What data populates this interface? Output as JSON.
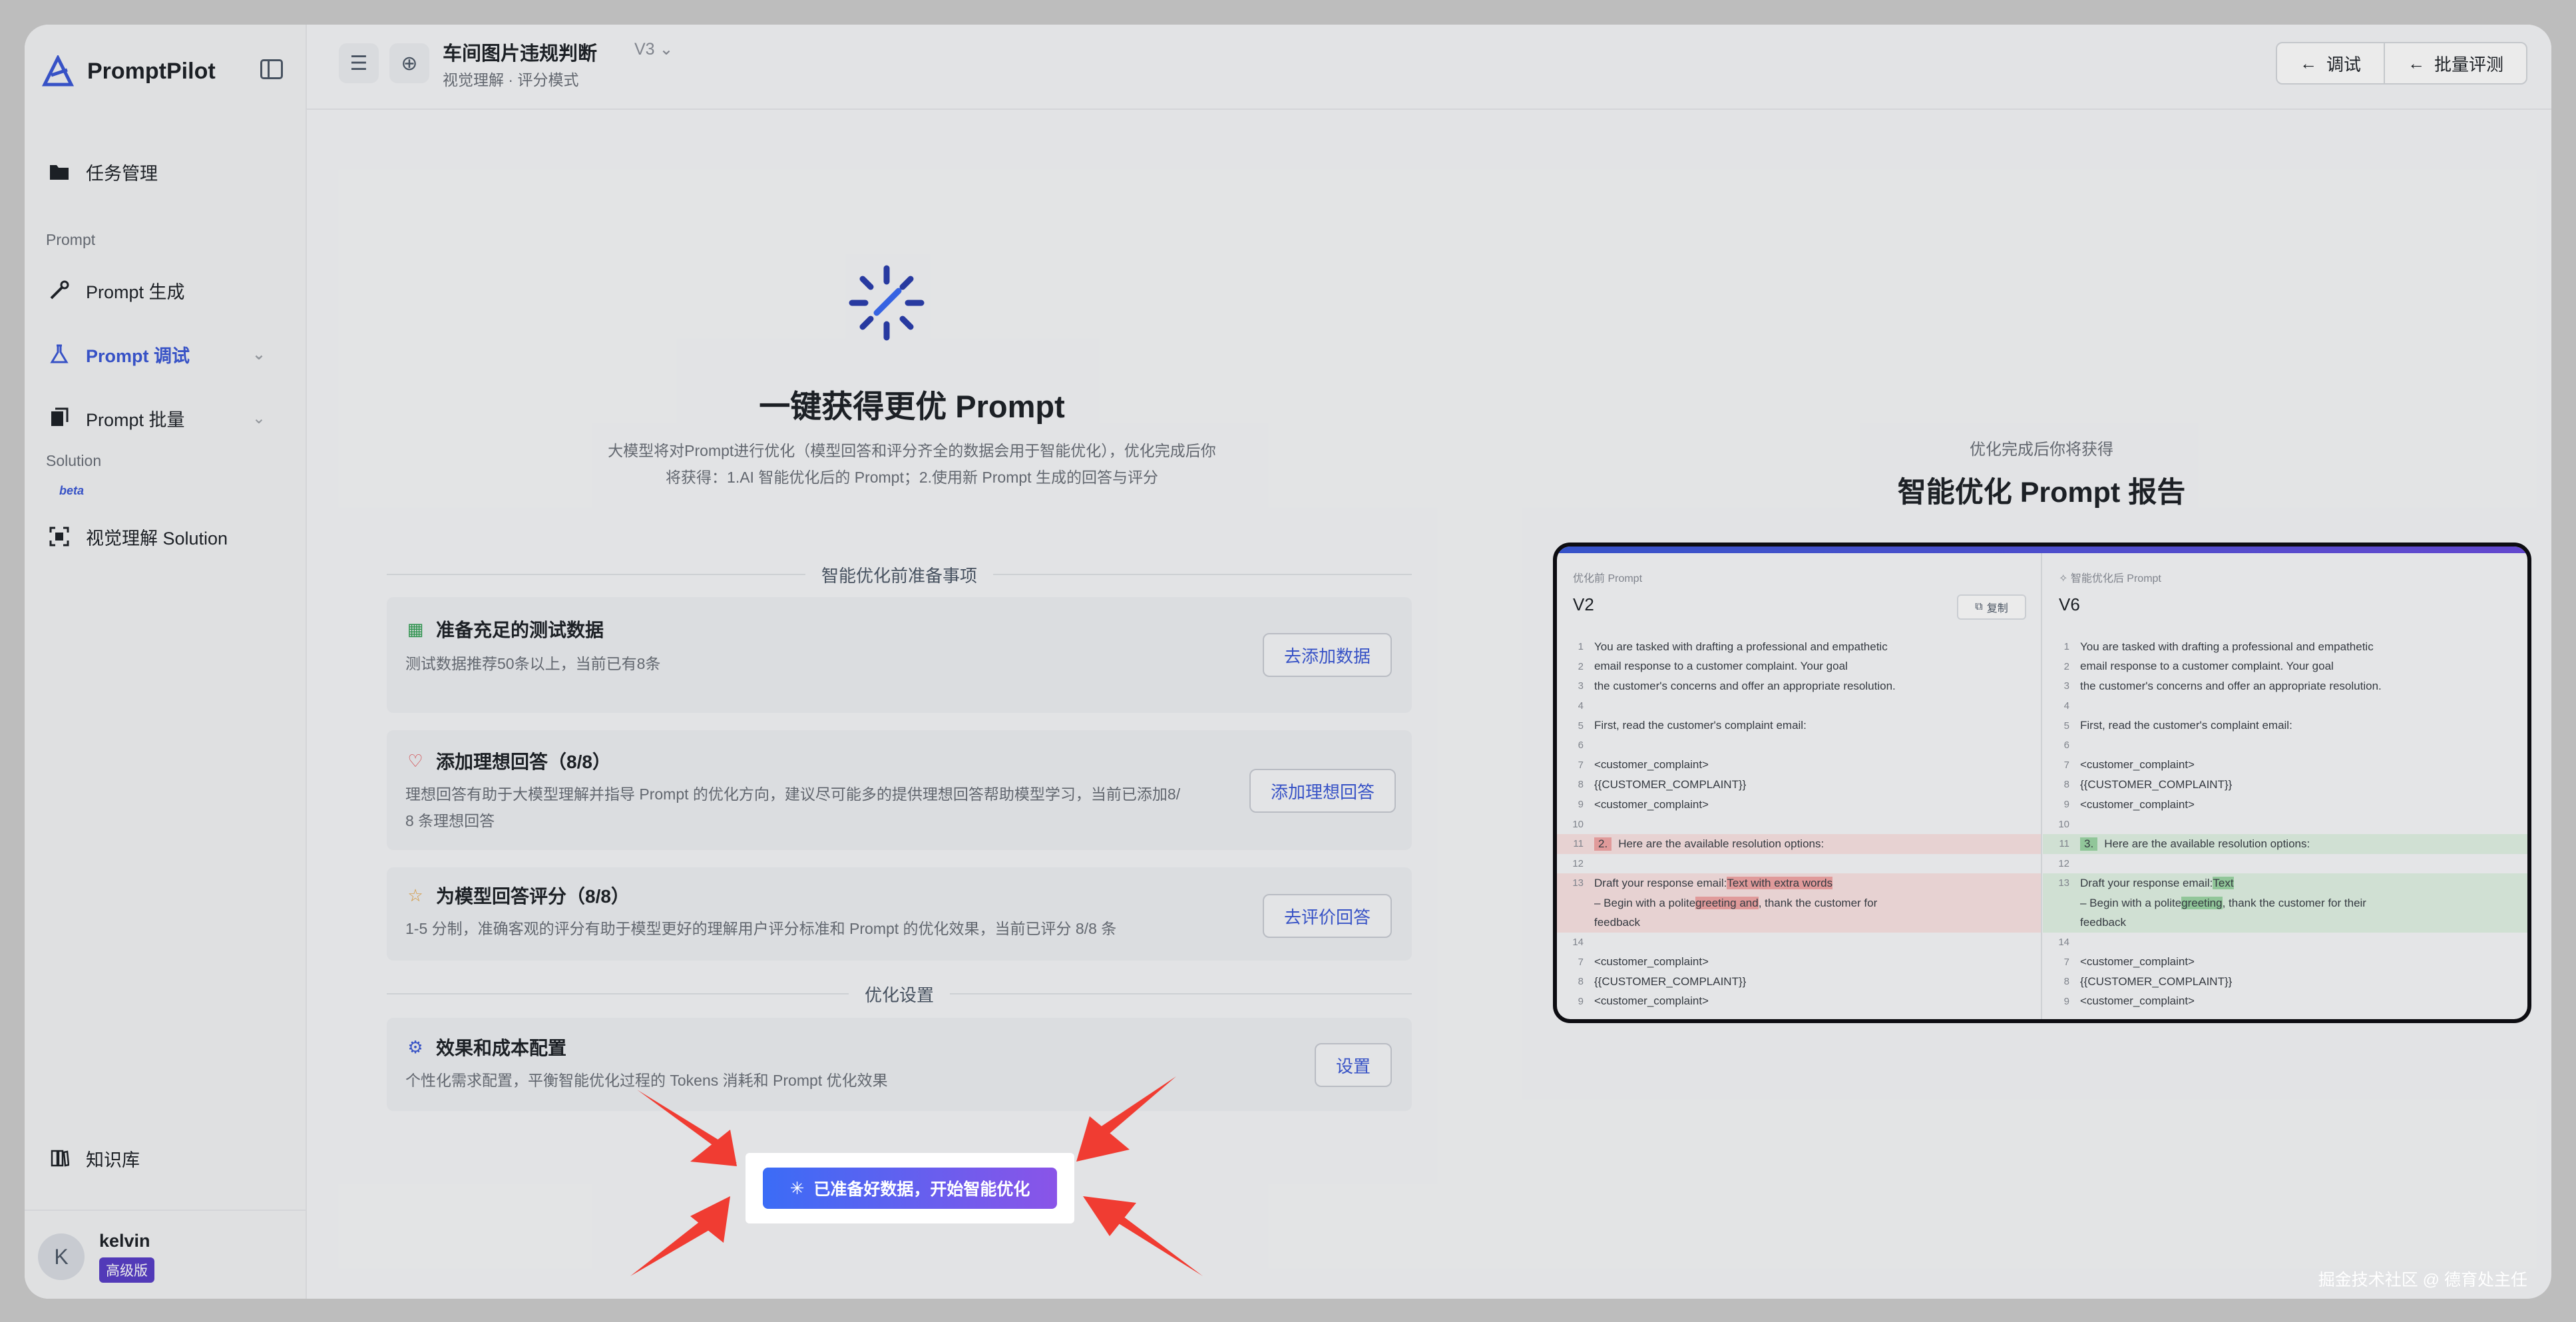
{
  "app": {
    "name": "PromptPilot"
  },
  "sidebar": {
    "task_mgmt": "任务管理",
    "section_prompt": "Prompt",
    "prompt_gen": "Prompt 生成",
    "prompt_debug": "Prompt 调试",
    "prompt_batch": "Prompt 批量",
    "section_solution": "Solution",
    "beta": "beta",
    "visual_solution": "视觉理解 Solution",
    "knowledge": "知识库",
    "user_name": "kelvin",
    "user_initial": "K",
    "user_badge": "高级版"
  },
  "header": {
    "title": "车间图片违规判断",
    "version": "V3",
    "subtitle": "视觉理解 · 评分模式",
    "btn_debug": "调试",
    "btn_batch": "批量评测"
  },
  "hero": {
    "title": "一键获得更优 Prompt",
    "desc_line1": "大模型将对Prompt进行优化（模型回答和评分齐全的数据会用于智能优化），优化完成后你",
    "desc_line2": "将获得：1.AI 智能优化后的 Prompt；2.使用新 Prompt 生成的回答与评分"
  },
  "prep": {
    "section_title": "智能优化前准备事项",
    "card1_title": "准备充足的测试数据",
    "card1_desc": "测试数据推荐50条以上，当前已有8条",
    "card1_btn": "去添加数据",
    "card2_title": "添加理想回答（8/8）",
    "card2_desc1": "理想回答有助于大模型理解并指导 Prompt 的优化方向，建议尽可能多的提供理想回答帮助模型学习，当前已添加8/",
    "card2_desc2": "8 条理想回答",
    "card2_btn": "添加理想回答",
    "card3_title": "为模型回答评分（8/8）",
    "card3_desc": "1-5 分制，准确客观的评分有助于模型更好的理解用户评分标准和 Prompt 的优化效果，当前已评分 8/8 条",
    "card3_btn": "去评价回答"
  },
  "settings": {
    "section_title": "优化设置",
    "card_title": "效果和成本配置",
    "card_desc": "个性化需求配置，平衡智能优化过程的 Tokens 消耗和 Prompt 优化效果",
    "card_btn": "设置"
  },
  "cta": {
    "label": "已准备好数据，开始智能优化"
  },
  "preview": {
    "sub": "优化完成后你将获得",
    "title": "智能优化 Prompt 报告",
    "left_tag": "优化前 Prompt",
    "left_version": "V2",
    "copy": "复制",
    "right_tag": "智能优化后 Prompt",
    "right_version": "V6",
    "lines_common": [
      {
        "n": "1",
        "t": "You are tasked with drafting a professional and empathetic"
      },
      {
        "n": "2",
        "t": "email response to a customer complaint. Your goal"
      },
      {
        "n": "3",
        "t": "the customer's concerns and offer an appropriate resolution."
      },
      {
        "n": "4",
        "t": ""
      },
      {
        "n": "5",
        "t": "First, read the customer's complaint email:"
      },
      {
        "n": "6",
        "t": ""
      },
      {
        "n": "7",
        "t": "<customer_complaint>"
      },
      {
        "n": "8",
        "t": "{{CUSTOMER_COMPLAINT}}"
      },
      {
        "n": "9",
        "t": "<customer_complaint>"
      },
      {
        "n": "10",
        "t": ""
      }
    ],
    "line11_num": "2.",
    "line11_num_right": "3.",
    "line11_text": "Here are the available resolution options:",
    "line12": "12",
    "line13_pre": "Draft your response email:",
    "line13_mark_left": "Text with extra words",
    "line13_mark_right": "Text",
    "line13b_pre": "– Begin with a polite",
    "line13b_mark_left": "greeting and",
    "line13b_mark_right": "greeting",
    "line13b_post": ", thank the customer for",
    "line13b_post_right": ", thank the customer for their",
    "line13c": "feedback",
    "line14": "14",
    "lines_tail": [
      {
        "n": "7",
        "t": "<customer_complaint>"
      },
      {
        "n": "8",
        "t": "{{CUSTOMER_COMPLAINT}}"
      },
      {
        "n": "9",
        "t": "<customer_complaint>"
      }
    ]
  },
  "watermark": "掘金技术社区 @ 德育处主任",
  "colors": {
    "accent": "#3c5ad7",
    "cta_start": "#3b6cf6",
    "cta_end": "#8a54e8",
    "arrow": "#f03c32"
  }
}
